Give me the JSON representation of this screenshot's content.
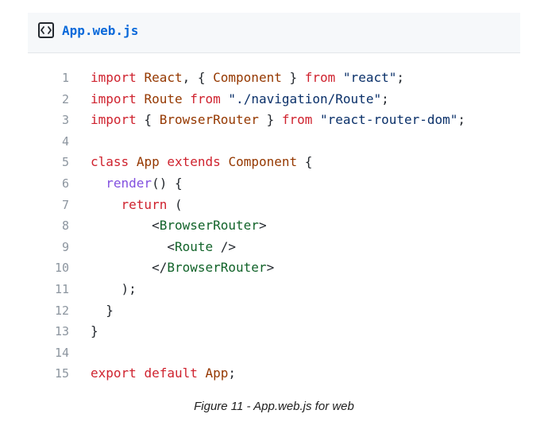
{
  "file": {
    "name": "App.web.js",
    "icon": "code-brackets-icon"
  },
  "colors": {
    "keyword": "#cf222e",
    "entity": "#953800",
    "string": "#0a3069",
    "function": "#8250df",
    "tag": "#116329",
    "plain": "#24292f",
    "line_number": "#8c959f",
    "file_name": "#0969da"
  },
  "code_lines": [
    {
      "number": "1",
      "tokens": [
        [
          "kw",
          "import"
        ],
        [
          "pl",
          " "
        ],
        [
          "ent",
          "React"
        ],
        [
          "pl",
          ", { "
        ],
        [
          "ent",
          "Component"
        ],
        [
          "pl",
          " } "
        ],
        [
          "kw",
          "from"
        ],
        [
          "pl",
          " "
        ],
        [
          "str",
          "\"react\""
        ],
        [
          "pl",
          ";"
        ]
      ]
    },
    {
      "number": "2",
      "tokens": [
        [
          "kw",
          "import"
        ],
        [
          "pl",
          " "
        ],
        [
          "ent",
          "Route"
        ],
        [
          "pl",
          " "
        ],
        [
          "kw",
          "from"
        ],
        [
          "pl",
          " "
        ],
        [
          "str",
          "\"./navigation/Route\""
        ],
        [
          "pl",
          ";"
        ]
      ]
    },
    {
      "number": "3",
      "tokens": [
        [
          "kw",
          "import"
        ],
        [
          "pl",
          " { "
        ],
        [
          "ent",
          "BrowserRouter"
        ],
        [
          "pl",
          " } "
        ],
        [
          "kw",
          "from"
        ],
        [
          "pl",
          " "
        ],
        [
          "str",
          "\"react-router-dom\""
        ],
        [
          "pl",
          ";"
        ]
      ]
    },
    {
      "number": "4",
      "tokens": []
    },
    {
      "number": "5",
      "tokens": [
        [
          "kw",
          "class"
        ],
        [
          "pl",
          " "
        ],
        [
          "ent",
          "App"
        ],
        [
          "pl",
          " "
        ],
        [
          "kw",
          "extends"
        ],
        [
          "pl",
          " "
        ],
        [
          "ent",
          "Component"
        ],
        [
          "pl",
          " {"
        ]
      ]
    },
    {
      "number": "6",
      "tokens": [
        [
          "pl",
          "  "
        ],
        [
          "fn",
          "render"
        ],
        [
          "pl",
          "() {"
        ]
      ]
    },
    {
      "number": "7",
      "tokens": [
        [
          "pl",
          "    "
        ],
        [
          "kw",
          "return"
        ],
        [
          "pl",
          " ("
        ]
      ]
    },
    {
      "number": "8",
      "tokens": [
        [
          "pl",
          "        <"
        ],
        [
          "tag",
          "BrowserRouter"
        ],
        [
          "pl",
          ">"
        ]
      ]
    },
    {
      "number": "9",
      "tokens": [
        [
          "pl",
          "          <"
        ],
        [
          "tag",
          "Route"
        ],
        [
          "pl",
          " />"
        ]
      ]
    },
    {
      "number": "10",
      "tokens": [
        [
          "pl",
          "        </"
        ],
        [
          "tag",
          "BrowserRouter"
        ],
        [
          "pl",
          ">"
        ]
      ]
    },
    {
      "number": "11",
      "tokens": [
        [
          "pl",
          "    );"
        ]
      ]
    },
    {
      "number": "12",
      "tokens": [
        [
          "pl",
          "  }"
        ]
      ]
    },
    {
      "number": "13",
      "tokens": [
        [
          "pl",
          "}"
        ]
      ]
    },
    {
      "number": "14",
      "tokens": []
    },
    {
      "number": "15",
      "tokens": [
        [
          "kw",
          "export"
        ],
        [
          "pl",
          " "
        ],
        [
          "kw",
          "default"
        ],
        [
          "pl",
          " "
        ],
        [
          "ent",
          "App"
        ],
        [
          "pl",
          ";"
        ]
      ]
    }
  ],
  "caption": "Figure 11 - App.web.js for web"
}
